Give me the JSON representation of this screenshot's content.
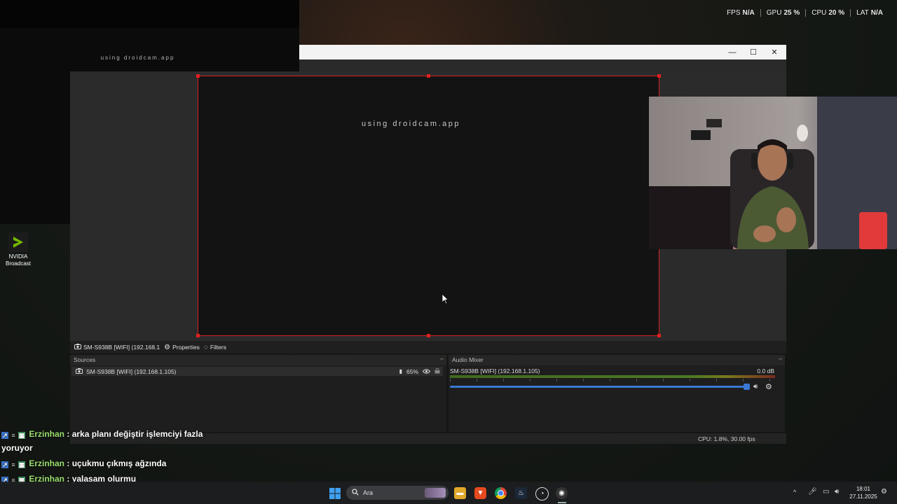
{
  "overlay_stats": [
    {
      "label": "FPS",
      "value": "N/A"
    },
    {
      "label": "GPU",
      "value": "25 %"
    },
    {
      "label": "CPU",
      "value": "20 %"
    },
    {
      "label": "LAT",
      "value": "N/A"
    }
  ],
  "droidcam_preview": {
    "watermark": "using droidcam.app"
  },
  "desktop": {
    "nvidia_label": "NVIDIA Broadcast"
  },
  "obs": {
    "window_buttons": {
      "minimize": "—",
      "maximize": "☐",
      "close": "✕"
    },
    "canvas_watermark": "using droidcam.app",
    "toolbar": {
      "source_name": "SM-S938B [WIFI] (192.168.1",
      "properties": "Properties",
      "filters": "Filters"
    },
    "sources_dock": {
      "title": "Sources",
      "items": [
        {
          "name": "SM-S938B [WIFI] (192.168.1.105)",
          "opacity": "65%"
        }
      ]
    },
    "audio_mixer": {
      "title": "Audio Mixer",
      "channel": {
        "name": "SM-S938B [WIFI] (192.168.1.105)",
        "level": "0.0 dB"
      }
    },
    "status": "CPU: 1.8%, 30.00 fps"
  },
  "chat": [
    {
      "user": "Erzinhan",
      "message": ": arka planı değiştir işlemciyi fazla"
    },
    {
      "continuation": "yoruyor"
    },
    {
      "user": "Erzinhan",
      "message": ": uçukmu çıkmış ağzında"
    },
    {
      "user": "Erzinhan",
      "message": ": yalasam olurmu"
    }
  ],
  "taskbar": {
    "search_placeholder": "Ara",
    "time": "18:01",
    "date": "27.11.2025"
  },
  "colors": {
    "selection_red": "#d8201f",
    "volume_blue": "#3b78d4",
    "chat_username": "#9be06f"
  }
}
